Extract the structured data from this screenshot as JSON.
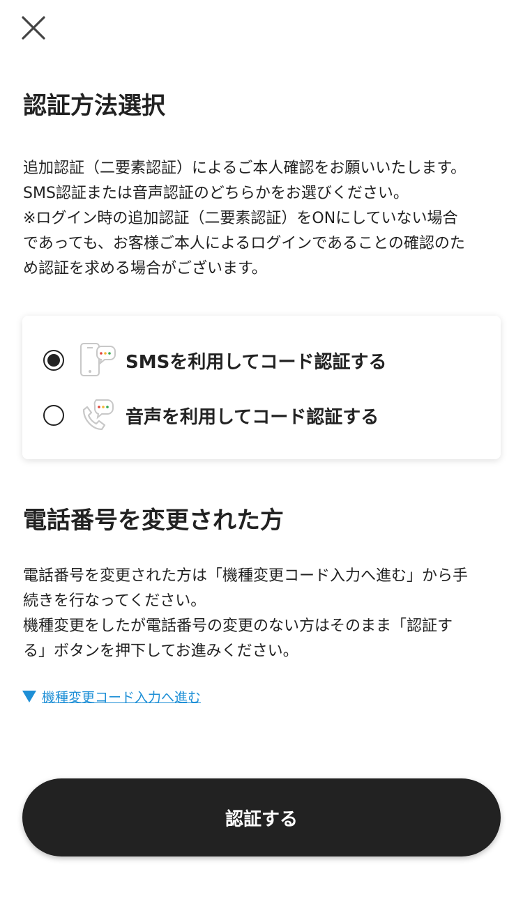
{
  "auth_section": {
    "title": "認証方法選択",
    "description": "追加認証（二要素認証）によるご本人確認をお願いいたします。\nSMS認証または音声認証のどちらかをお選びください。\n※ログイン時の追加認証（二要素認証）をONにしていない場合\nであっても、お客様ご本人によるログインであることの確認のた\nめ認証を求める場合がございます。"
  },
  "options": [
    {
      "label": "SMSを利用してコード認証する",
      "icon": "phone-sms-icon",
      "selected": true
    },
    {
      "label": "音声を利用してコード認証する",
      "icon": "phone-voice-icon",
      "selected": false
    }
  ],
  "phone_change_section": {
    "title": "電話番号を変更された方",
    "description": "電話番号を変更された方は「機種変更コード入力へ進む」から手\n続きを行なってください。\n機種変更をしたが電話番号の変更のない方はそのまま「認証す\nる」ボタンを押下してお進みください。",
    "link_label": "機種変更コード入力へ進む"
  },
  "submit_label": "認証する",
  "colors": {
    "text": "#222222",
    "link": "#1e8fd6",
    "button_bg": "#222222",
    "bubble_dot_red": "#e0453a",
    "bubble_dot_yellow": "#f2b636",
    "bubble_dot_green": "#37a852"
  }
}
